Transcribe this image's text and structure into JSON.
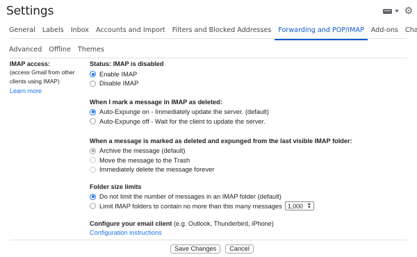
{
  "header": {
    "title": "Settings",
    "icons": [
      "keyboard-icon",
      "caret-down-icon",
      "gear-icon"
    ],
    "gear_glyph": "⚙"
  },
  "tabs": {
    "row1": [
      {
        "label": "General",
        "active": false
      },
      {
        "label": "Labels",
        "active": false
      },
      {
        "label": "Inbox",
        "active": false
      },
      {
        "label": "Accounts and Import",
        "active": false
      },
      {
        "label": "Filters and Blocked Addresses",
        "active": false
      },
      {
        "label": "Forwarding and POP/IMAP",
        "active": true
      },
      {
        "label": "Add-ons",
        "active": false
      },
      {
        "label": "Chat",
        "active": false
      }
    ],
    "row2": [
      {
        "label": "Advanced",
        "active": false
      },
      {
        "label": "Offline",
        "active": false
      },
      {
        "label": "Themes",
        "active": false
      }
    ]
  },
  "imap": {
    "section_title": "IMAP access:",
    "section_sub": "(access Gmail from other clients using IMAP)",
    "learn_more": "Learn more",
    "status": "Status: IMAP is disabled",
    "access_options": [
      {
        "label": "Enable IMAP",
        "selected": true
      },
      {
        "label": "Disable IMAP",
        "selected": false
      }
    ],
    "deleted_heading": "When I mark a message in IMAP as deleted:",
    "deleted_options": [
      {
        "label": "Auto-Expunge on - Immediately update the server. (default)",
        "selected": true
      },
      {
        "label": "Auto-Expunge off - Wait for the client to update the server.",
        "selected": false
      }
    ],
    "expunged_heading": "When a message is marked as deleted and expunged from the last visible IMAP folder:",
    "expunged_options": [
      {
        "label": "Archive the message (default)",
        "selected": true
      },
      {
        "label": "Move the message to the Trash",
        "selected": false
      },
      {
        "label": "Immediately delete the message forever",
        "selected": false
      }
    ],
    "folder_heading": "Folder size limits",
    "folder_options": [
      {
        "label": "Do not limit the number of messages in an IMAP folder (default)",
        "selected": true
      },
      {
        "label": "Limit IMAP folders to contain no more than this many messages",
        "selected": false
      }
    ],
    "folder_limit_value": "1,000",
    "client_heading_bold": "Configure your email client",
    "client_heading_rest": " (e.g. Outlook, Thunderbird, iPhone)",
    "client_link": "Configuration instructions"
  },
  "footer": {
    "save_label": "Save Changes",
    "cancel_label": "Cancel"
  },
  "colors": {
    "accent": "#0b57d0",
    "link": "#1a73e8",
    "text": "#202124"
  }
}
